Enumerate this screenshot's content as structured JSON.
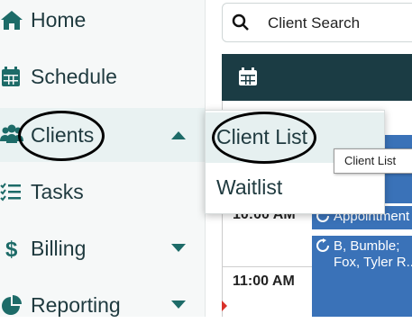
{
  "sidebar": {
    "items": [
      {
        "label": "Home",
        "icon": "home-icon"
      },
      {
        "label": "Schedule",
        "icon": "calendar-icon"
      },
      {
        "label": "Clients",
        "icon": "users-icon",
        "expanded": true
      },
      {
        "label": "Tasks",
        "icon": "checklist-icon"
      },
      {
        "label": "Billing",
        "icon": "dollar-icon"
      },
      {
        "label": "Reporting",
        "icon": "pie-chart-icon"
      }
    ]
  },
  "clients_menu": {
    "items": [
      {
        "label": "Client List"
      },
      {
        "label": "Waitlist"
      }
    ],
    "tooltip": "Client List"
  },
  "search": {
    "placeholder": "Client Search"
  },
  "calendar": {
    "times": [
      "10:00 AM",
      "11:00 AM"
    ],
    "appointments": [
      {
        "text": "Appointment"
      },
      {
        "line1": "B, Bumble;",
        "line2": "Fox, Tyler R..."
      }
    ]
  },
  "colors": {
    "accent": "#1d6b68",
    "header": "#1b3c44",
    "appointment": "#3a72b8"
  }
}
